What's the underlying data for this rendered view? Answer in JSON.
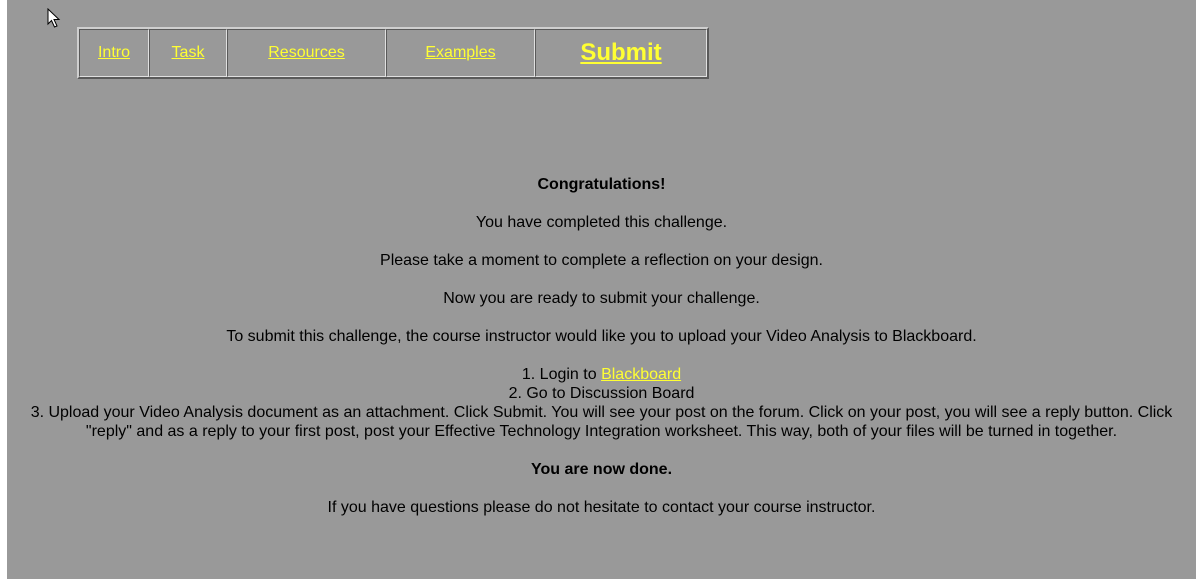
{
  "nav": {
    "items": [
      {
        "label": "Intro"
      },
      {
        "label": "Task"
      },
      {
        "label": "Resources"
      },
      {
        "label": "Examples"
      },
      {
        "label": "Submit"
      }
    ]
  },
  "content": {
    "heading": "Congratulations!",
    "completed": "You have completed this challenge.",
    "reflection": "Please take a moment to complete a reflection on your design.",
    "ready": "Now you are ready to submit your challenge.",
    "instructions": "To submit this challenge, the course instructor would like you to upload your Video Analysis to Blackboard.",
    "steps": {
      "step1_prefix": "1. Login to ",
      "step1_link": "Blackboard",
      "step2": "2. Go to Discussion Board",
      "step3": "3. Upload your Video Analysis document as an attachment. Click Submit. You will see your post on the forum. Click on your post, you will see a reply button. Click \"reply\" and as a reply to your first post, post your Effective Technology Integration worksheet. This way, both of your files will be turned in together."
    },
    "done": "You are now done.",
    "questions": "If you have questions please do not hesitate to contact your course instructor."
  },
  "colors": {
    "background": "#999999",
    "link": "#ffff33"
  }
}
